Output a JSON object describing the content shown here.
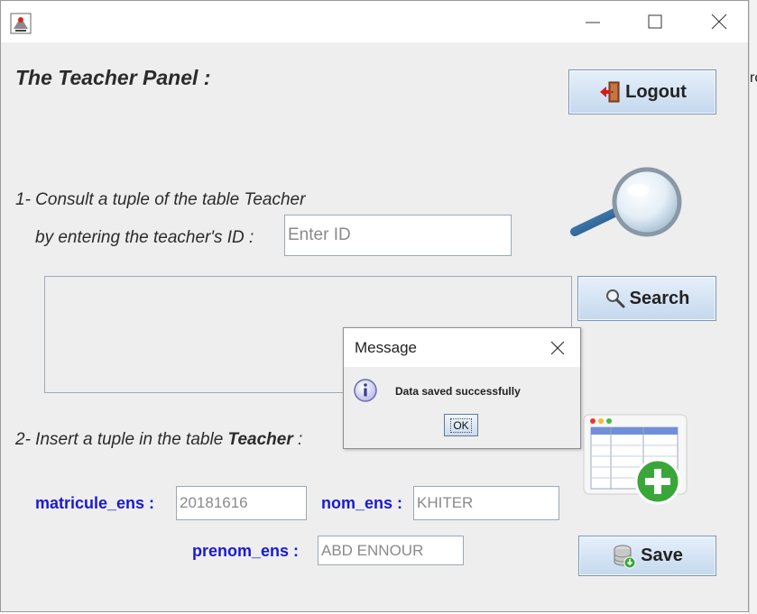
{
  "panel": {
    "title": "The Teacher Panel :",
    "logout_label": "Logout",
    "search_label": "Search",
    "save_label": "Save"
  },
  "consult": {
    "line1": "1- Consult a tuple of the table Teacher",
    "line2": "by entering the teacher's ID :",
    "id_placeholder": "Enter ID",
    "result_text": ""
  },
  "insert": {
    "heading_prefix": "2- Insert a tuple in the table ",
    "heading_bold": "Teacher",
    "heading_suffix": " :",
    "matricule_label": "matricule_ens :",
    "matricule_value": "20181616",
    "nom_label": "nom_ens :",
    "nom_value": "KHITER",
    "prenom_label": "prenom_ens :",
    "prenom_value": "ABD ENNOUR"
  },
  "dialog": {
    "title": "Message",
    "message": "Data saved successfully",
    "ok_label": "OK"
  },
  "background_fragment": "ro",
  "icons": [
    "java-app-icon",
    "minimize-icon",
    "maximize-icon",
    "close-icon",
    "logout-door-icon",
    "magnifier-icon",
    "search-icon",
    "info-icon",
    "table-add-icon",
    "database-save-icon"
  ],
  "colors": {
    "window_bg": "#eeeeee",
    "button_gradient_top": "#e6f0fa",
    "button_gradient_bottom": "#c4d8ee",
    "label_blue": "#1a1ad0"
  }
}
